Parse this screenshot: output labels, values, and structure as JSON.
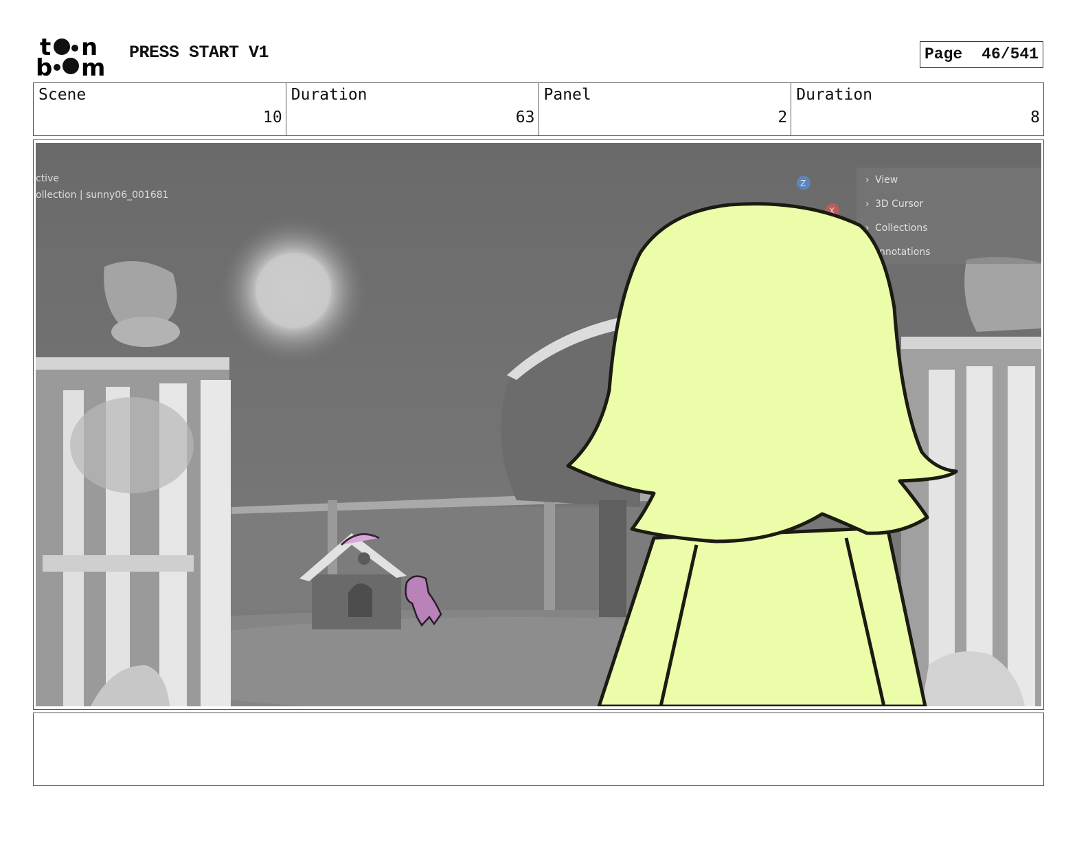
{
  "header": {
    "title": "PRESS START V1",
    "page_label": "Page",
    "page_number": "46/541"
  },
  "info": {
    "scene_label": "Scene",
    "scene_value": "10",
    "scene_duration_label": "Duration",
    "scene_duration_value": "63",
    "panel_label": "Panel",
    "panel_value": "2",
    "panel_duration_label": "Duration",
    "panel_duration_value": "8"
  },
  "viewport_overlay": {
    "line1": "ctive",
    "line2": "ollection | sunny06_001681",
    "menu_items": [
      "View",
      "3D Cursor",
      "Collections",
      "nnotations"
    ],
    "gizmo_z": "Z",
    "gizmo_x": "X"
  },
  "colors": {
    "hair": "#ebfda8",
    "background_gray": "#6e6e6e",
    "dog": "#b983b9"
  }
}
